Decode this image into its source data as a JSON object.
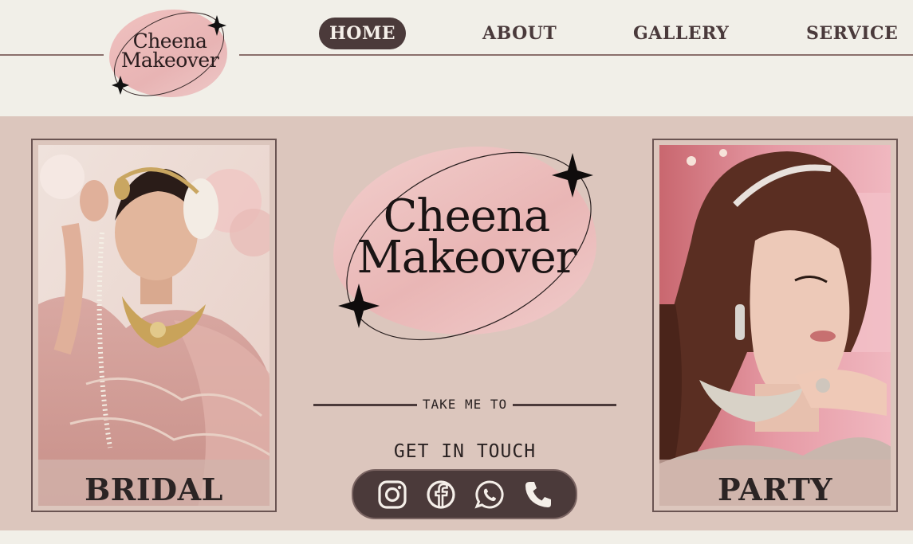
{
  "brand": {
    "name_line1": "Cheena",
    "name_line2": "Makeover"
  },
  "nav": {
    "items": [
      {
        "label": "HOME",
        "active": true
      },
      {
        "label": "ABOUT",
        "active": false
      },
      {
        "label": "GALLERY",
        "active": false
      },
      {
        "label": "SERVICE",
        "active": false
      }
    ]
  },
  "hero": {
    "left_card": {
      "caption": "BRIDAL"
    },
    "right_card": {
      "caption": "PARTY"
    },
    "logo": {
      "line1": "Cheena",
      "line2": "Makeover"
    },
    "take_me_to": "TAKE ME TO",
    "get_in_touch": "GET IN TOUCH",
    "social": [
      {
        "icon": "instagram-icon"
      },
      {
        "icon": "facebook-icon"
      },
      {
        "icon": "whatsapp-icon"
      },
      {
        "icon": "phone-icon"
      }
    ]
  },
  "colors": {
    "background": "#f1efe8",
    "hero_background": "#dcc6bd",
    "accent_dark": "#4b3a3a",
    "blob_pink": "#e9b6b5"
  }
}
